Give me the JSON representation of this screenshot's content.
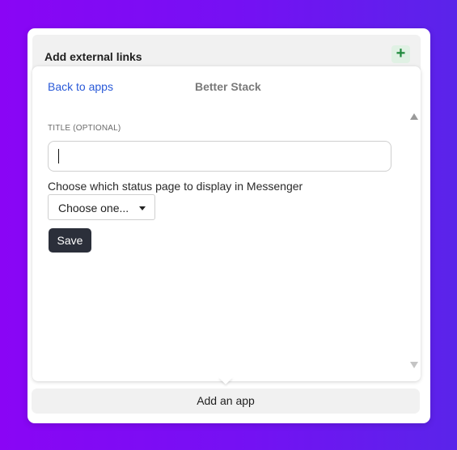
{
  "header": {
    "title": "Add external links",
    "add_icon": "+"
  },
  "panel": {
    "back_label": "Back to apps",
    "app_name": "Better Stack",
    "form": {
      "title_label": "TITLE (OPTIONAL)",
      "title_value": "",
      "status_label": "Choose which status page to display in Messenger",
      "status_select_value": "Choose one...",
      "save_label": "Save"
    }
  },
  "footer": {
    "add_app_label": "Add an app"
  },
  "colors": {
    "background_start": "#8a05f5",
    "background_end": "#5a24ea",
    "link": "#2a5ad8",
    "save_button": "#2b2f3a"
  }
}
